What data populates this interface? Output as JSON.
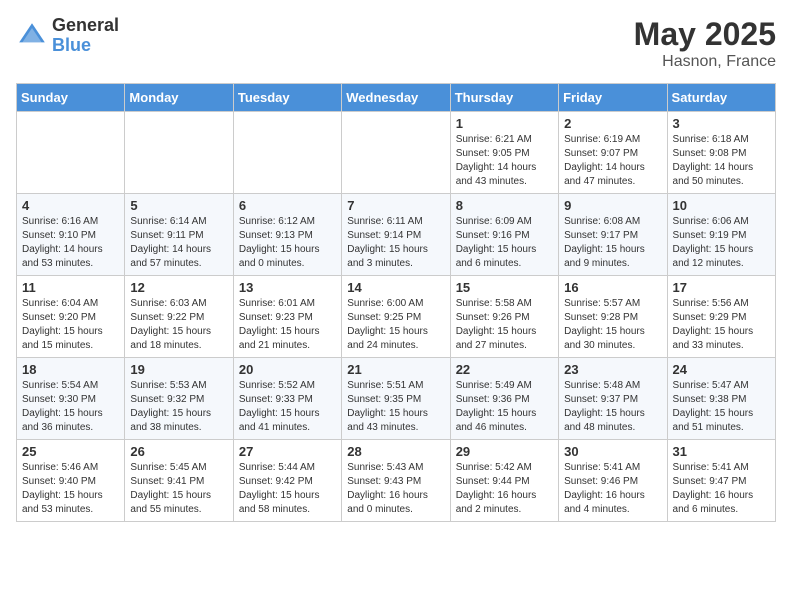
{
  "header": {
    "logo_general": "General",
    "logo_blue": "Blue",
    "month_year": "May 2025",
    "location": "Hasnon, France"
  },
  "weekdays": [
    "Sunday",
    "Monday",
    "Tuesday",
    "Wednesday",
    "Thursday",
    "Friday",
    "Saturday"
  ],
  "weeks": [
    [
      {
        "day": "",
        "info": ""
      },
      {
        "day": "",
        "info": ""
      },
      {
        "day": "",
        "info": ""
      },
      {
        "day": "",
        "info": ""
      },
      {
        "day": "1",
        "info": "Sunrise: 6:21 AM\nSunset: 9:05 PM\nDaylight: 14 hours\nand 43 minutes."
      },
      {
        "day": "2",
        "info": "Sunrise: 6:19 AM\nSunset: 9:07 PM\nDaylight: 14 hours\nand 47 minutes."
      },
      {
        "day": "3",
        "info": "Sunrise: 6:18 AM\nSunset: 9:08 PM\nDaylight: 14 hours\nand 50 minutes."
      }
    ],
    [
      {
        "day": "4",
        "info": "Sunrise: 6:16 AM\nSunset: 9:10 PM\nDaylight: 14 hours\nand 53 minutes."
      },
      {
        "day": "5",
        "info": "Sunrise: 6:14 AM\nSunset: 9:11 PM\nDaylight: 14 hours\nand 57 minutes."
      },
      {
        "day": "6",
        "info": "Sunrise: 6:12 AM\nSunset: 9:13 PM\nDaylight: 15 hours\nand 0 minutes."
      },
      {
        "day": "7",
        "info": "Sunrise: 6:11 AM\nSunset: 9:14 PM\nDaylight: 15 hours\nand 3 minutes."
      },
      {
        "day": "8",
        "info": "Sunrise: 6:09 AM\nSunset: 9:16 PM\nDaylight: 15 hours\nand 6 minutes."
      },
      {
        "day": "9",
        "info": "Sunrise: 6:08 AM\nSunset: 9:17 PM\nDaylight: 15 hours\nand 9 minutes."
      },
      {
        "day": "10",
        "info": "Sunrise: 6:06 AM\nSunset: 9:19 PM\nDaylight: 15 hours\nand 12 minutes."
      }
    ],
    [
      {
        "day": "11",
        "info": "Sunrise: 6:04 AM\nSunset: 9:20 PM\nDaylight: 15 hours\nand 15 minutes."
      },
      {
        "day": "12",
        "info": "Sunrise: 6:03 AM\nSunset: 9:22 PM\nDaylight: 15 hours\nand 18 minutes."
      },
      {
        "day": "13",
        "info": "Sunrise: 6:01 AM\nSunset: 9:23 PM\nDaylight: 15 hours\nand 21 minutes."
      },
      {
        "day": "14",
        "info": "Sunrise: 6:00 AM\nSunset: 9:25 PM\nDaylight: 15 hours\nand 24 minutes."
      },
      {
        "day": "15",
        "info": "Sunrise: 5:58 AM\nSunset: 9:26 PM\nDaylight: 15 hours\nand 27 minutes."
      },
      {
        "day": "16",
        "info": "Sunrise: 5:57 AM\nSunset: 9:28 PM\nDaylight: 15 hours\nand 30 minutes."
      },
      {
        "day": "17",
        "info": "Sunrise: 5:56 AM\nSunset: 9:29 PM\nDaylight: 15 hours\nand 33 minutes."
      }
    ],
    [
      {
        "day": "18",
        "info": "Sunrise: 5:54 AM\nSunset: 9:30 PM\nDaylight: 15 hours\nand 36 minutes."
      },
      {
        "day": "19",
        "info": "Sunrise: 5:53 AM\nSunset: 9:32 PM\nDaylight: 15 hours\nand 38 minutes."
      },
      {
        "day": "20",
        "info": "Sunrise: 5:52 AM\nSunset: 9:33 PM\nDaylight: 15 hours\nand 41 minutes."
      },
      {
        "day": "21",
        "info": "Sunrise: 5:51 AM\nSunset: 9:35 PM\nDaylight: 15 hours\nand 43 minutes."
      },
      {
        "day": "22",
        "info": "Sunrise: 5:49 AM\nSunset: 9:36 PM\nDaylight: 15 hours\nand 46 minutes."
      },
      {
        "day": "23",
        "info": "Sunrise: 5:48 AM\nSunset: 9:37 PM\nDaylight: 15 hours\nand 48 minutes."
      },
      {
        "day": "24",
        "info": "Sunrise: 5:47 AM\nSunset: 9:38 PM\nDaylight: 15 hours\nand 51 minutes."
      }
    ],
    [
      {
        "day": "25",
        "info": "Sunrise: 5:46 AM\nSunset: 9:40 PM\nDaylight: 15 hours\nand 53 minutes."
      },
      {
        "day": "26",
        "info": "Sunrise: 5:45 AM\nSunset: 9:41 PM\nDaylight: 15 hours\nand 55 minutes."
      },
      {
        "day": "27",
        "info": "Sunrise: 5:44 AM\nSunset: 9:42 PM\nDaylight: 15 hours\nand 58 minutes."
      },
      {
        "day": "28",
        "info": "Sunrise: 5:43 AM\nSunset: 9:43 PM\nDaylight: 16 hours\nand 0 minutes."
      },
      {
        "day": "29",
        "info": "Sunrise: 5:42 AM\nSunset: 9:44 PM\nDaylight: 16 hours\nand 2 minutes."
      },
      {
        "day": "30",
        "info": "Sunrise: 5:41 AM\nSunset: 9:46 PM\nDaylight: 16 hours\nand 4 minutes."
      },
      {
        "day": "31",
        "info": "Sunrise: 5:41 AM\nSunset: 9:47 PM\nDaylight: 16 hours\nand 6 minutes."
      }
    ]
  ]
}
